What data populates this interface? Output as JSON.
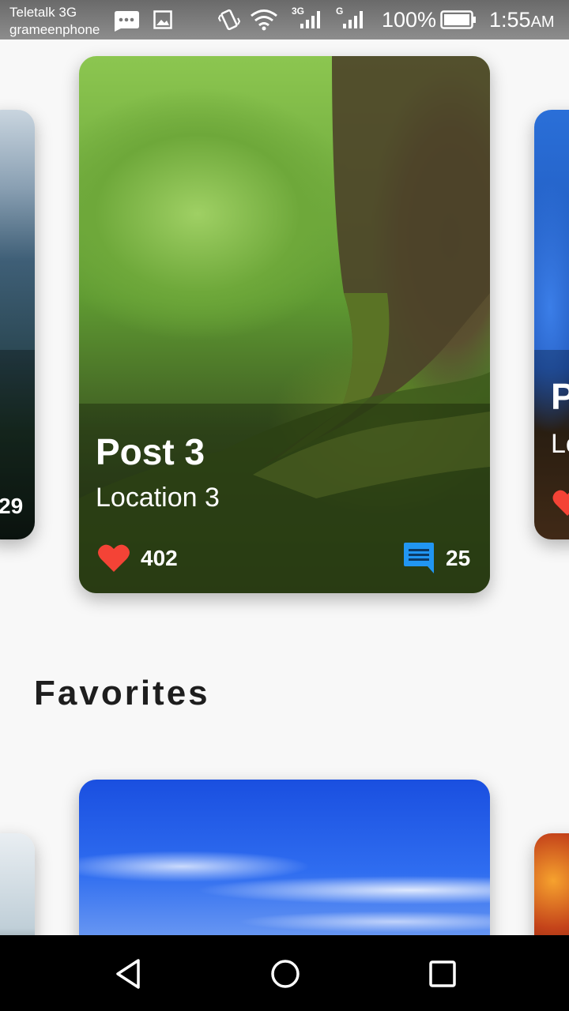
{
  "status_bar": {
    "carrier_primary": "Teletalk 3G",
    "carrier_secondary": "grameenphone",
    "network_1": "3G",
    "network_2": "G",
    "battery_percent": "100%",
    "time": "1:55",
    "time_suffix": "AM",
    "icons": [
      "messenger-icon",
      "image-icon",
      "vibrate-icon",
      "wifi-icon",
      "signal-3g-icon",
      "signal-g-icon",
      "battery-icon"
    ]
  },
  "featured_carousel": {
    "left_peek": {
      "likes": "29"
    },
    "active_card": {
      "title": "Post 3",
      "location": "Location 3",
      "likes": "402",
      "comments": "25"
    },
    "right_peek": {
      "title_fragment": "P",
      "location_fragment": "Lo"
    }
  },
  "favorites": {
    "heading": "Favorites"
  },
  "colors": {
    "heart": "#f44336",
    "comment": "#2196f3",
    "background": "#f8f8f8"
  },
  "nav_bar": {
    "icons": [
      "back-triangle-icon",
      "home-circle-icon",
      "recents-square-icon"
    ]
  }
}
